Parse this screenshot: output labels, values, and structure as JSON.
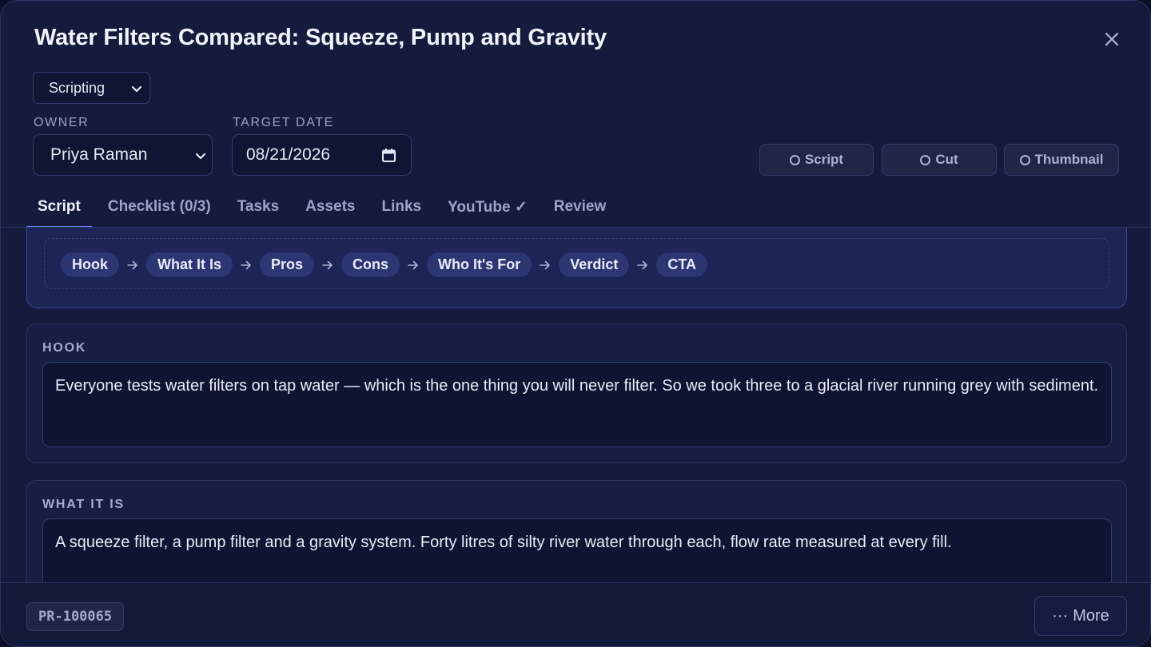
{
  "dialog": {
    "title": "Water Filters Compared: Squeeze, Pump and Gravity",
    "close_icon": "close-icon"
  },
  "status": {
    "selected": "Scripting"
  },
  "owner": {
    "label": "OWNER",
    "selected": "Priya Raman"
  },
  "target_date": {
    "label": "TARGET DATE",
    "value": "08/21/2026"
  },
  "deliverables": [
    {
      "label": "Script",
      "done": false
    },
    {
      "label": "Cut",
      "done": false
    },
    {
      "label": "Thumbnail",
      "done": false
    }
  ],
  "tabs": [
    {
      "label": "Script",
      "active": true
    },
    {
      "label": "Checklist (0/3)",
      "active": false
    },
    {
      "label": "Tasks",
      "active": false
    },
    {
      "label": "Assets",
      "active": false
    },
    {
      "label": "Links",
      "active": false
    },
    {
      "label": "YouTube ✓",
      "active": false
    },
    {
      "label": "Review",
      "active": false
    }
  ],
  "flow": [
    "Hook",
    "What It Is",
    "Pros",
    "Cons",
    "Who It's For",
    "Verdict",
    "CTA"
  ],
  "sections": [
    {
      "label": "HOOK",
      "text": "Everyone tests water filters on tap water — which is the one thing you will never filter. So we took three to a glacial river running grey with sediment."
    },
    {
      "label": "WHAT IT IS",
      "text": "A squeeze filter, a pump filter and a gravity system. Forty litres of silty river water through each, flow rate measured at every fill."
    }
  ],
  "footer": {
    "ref": "PR-100065",
    "more_label": "More",
    "more_icon": "ellipsis-icon"
  },
  "colors": {
    "accent": "#6f82ff",
    "background": "#141b3d",
    "chip": "#2c3672"
  }
}
